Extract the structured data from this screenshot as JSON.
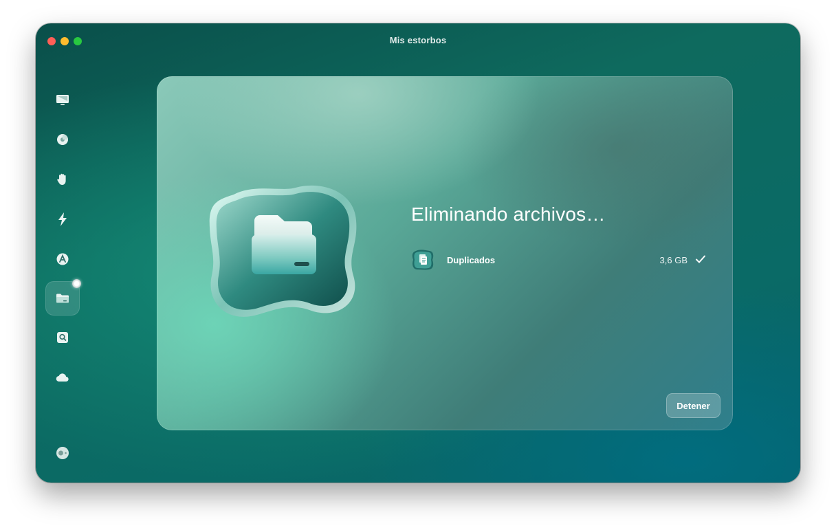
{
  "window": {
    "title": "Mis estorbos",
    "traffic_lights": [
      "close",
      "minimize",
      "maximize"
    ]
  },
  "sidebar": {
    "items": [
      {
        "icon": "monitor-icon",
        "active": false
      },
      {
        "icon": "disk-scan-icon",
        "active": false
      },
      {
        "icon": "hand-privacy-icon",
        "active": false
      },
      {
        "icon": "lightning-icon",
        "active": false
      },
      {
        "icon": "apps-icon",
        "active": false
      },
      {
        "icon": "folder-icon",
        "active": true,
        "badge": true
      },
      {
        "icon": "magnifier-drive-icon",
        "active": false
      },
      {
        "icon": "cloud-icon",
        "active": false
      }
    ],
    "footer_icon": "assistant-toggle-icon"
  },
  "main": {
    "hero_icon": "folder-blob-icon",
    "heading": "Eliminando archivos…",
    "items": [
      {
        "icon": "duplicates-icon",
        "name": "Duplicados",
        "size": "3,6 GB",
        "status_icon": "checkmark-icon"
      }
    ],
    "stop_label": "Detener"
  },
  "colors": {
    "accent": "#0e6a5e",
    "close": "#ff5f57",
    "minimize": "#febc2e",
    "maximize": "#28c840"
  }
}
